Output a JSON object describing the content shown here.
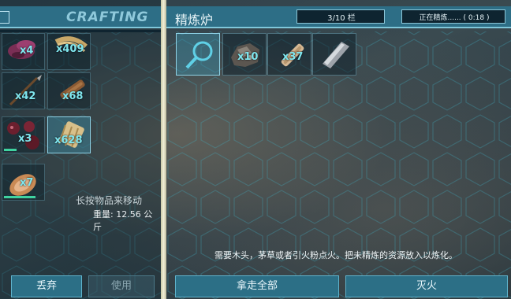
{
  "left_panel": {
    "tab_title": "CRAFTING",
    "inventory": [
      {
        "icon": "hide-icon",
        "qty": "x4"
      },
      {
        "icon": "fiber-icon",
        "qty": "x409"
      },
      {
        "icon": "spear-icon",
        "qty": "x42"
      },
      {
        "icon": "wood-icon",
        "qty": "x68"
      },
      {
        "icon": "berries-icon",
        "qty": "x3"
      },
      {
        "icon": "thatch-icon",
        "qty": "x628"
      },
      {
        "icon": "meat-icon",
        "qty": "x7"
      }
    ],
    "hint": "长按物品来移动",
    "weight": "重量: 12.56 公斤",
    "drop_button": "丢弃",
    "use_button": "使用"
  },
  "right_panel": {
    "title": "精炼炉",
    "slots_status": "3/10 栏",
    "craft_status": "正在精炼...... ( 0:18 )",
    "items": [
      {
        "icon": "search-icon",
        "qty": ""
      },
      {
        "icon": "metal-ore-icon",
        "qty": "x10"
      },
      {
        "icon": "wood-icon",
        "qty": "x37"
      },
      {
        "icon": "metal-ingot-icon",
        "qty": ""
      }
    ],
    "info_text": "需要木头，茅草或者引火粉点火。把未精炼的资源放入以炼化。",
    "take_all_button": "拿走全部",
    "extinguish_button": "灭火"
  },
  "colors": {
    "accent": "#2d6e86",
    "quantity_text": "#7fe6ee",
    "divider": "#f2f0d8"
  }
}
